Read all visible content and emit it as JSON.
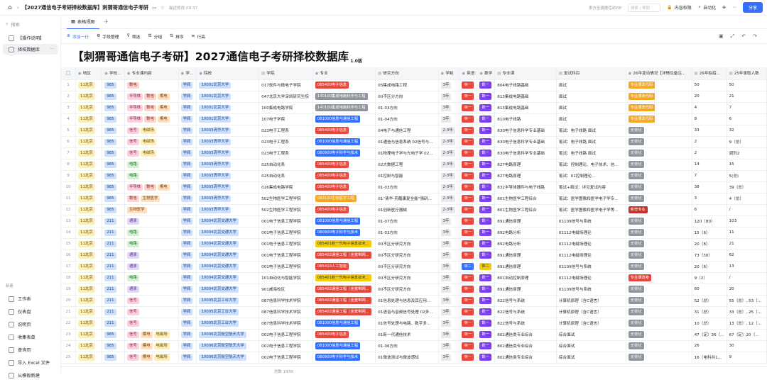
{
  "topbar": {
    "title": "【2027通信电子考研择校数据库】刺猬哥通信电子考研",
    "saved": "最近修改 00:37",
    "vip": "来方至演播活动VIP",
    "vip_box": "搜索 / 帮助",
    "btn_permission": "内容权限",
    "btn_automation": "自动化",
    "share": "分享"
  },
  "sidebar": {
    "search": "搜索",
    "items": [
      "【操作说明】",
      "择校数据库"
    ],
    "section": "新建",
    "new_items": [
      "工作表",
      "仪表盘",
      "说明页",
      "收集表单",
      "查询页",
      "导入 Excel 文件",
      "从模板新建"
    ]
  },
  "view": {
    "tab": "表格视图",
    "plus": "+"
  },
  "toolbar": {
    "add": "添加一行",
    "fields": "字段管理",
    "filter": "筛选",
    "group": "分组",
    "sort": "排序",
    "height": "行高"
  },
  "banner": {
    "title": "【刺猬哥通信电子考研】2027通信电子考研择校数据库",
    "sub": "1.0版"
  },
  "headers": [
    "",
    "地区",
    "学校...",
    "专业课内容",
    "学...",
    "院校",
    "学院",
    "专业",
    "研究方向",
    "学制",
    "英语",
    "数学",
    "专业课",
    "复试科目",
    "26年变动情况【详情见备注...",
    "26年拟招...",
    "25年录取人数"
  ],
  "header_icons": [
    "",
    "◉",
    "◉",
    "◉",
    "◉",
    "◉",
    "▤",
    "◉",
    "▤",
    "◉",
    "◉",
    "◉",
    "▤",
    "▤",
    "◉",
    "▤",
    "▤"
  ],
  "rows": [
    {
      "n": "1",
      "area": "11北京",
      "lvl": "985",
      "subj": [
        [
          "数电",
          "t-red"
        ]
      ],
      "type": "学硕",
      "school": "10001北京大学",
      "college": "017软件与微电子学院",
      "major": [
        "085400电子信息",
        "b-red"
      ],
      "dir": "05集成电路工程",
      "len": "3年",
      "en": [
        "英一",
        "b-red"
      ],
      "math": [
        "数一",
        "b-purple"
      ],
      "course": "804电子线路基础",
      "retest": "面试",
      "chg": [
        "专业课改代码",
        "b-orange"
      ],
      "plan": "50",
      "adm": "50"
    },
    {
      "n": "2",
      "area": "11北京",
      "lvl": "985",
      "subj": [
        [
          "半导体",
          "t-pink"
        ],
        [
          "数电",
          "t-red"
        ],
        [
          "模电",
          "t-orange"
        ]
      ],
      "type": "学硕",
      "school": "10001北京大学",
      "college": "047北京大学深圳研究生院",
      "major": [
        "140100集成电路科学与工程",
        "b-gray"
      ],
      "dir": "00不区分方向",
      "len": "3年",
      "en": [
        "英一",
        "b-red"
      ],
      "math": [
        "数一",
        "b-purple"
      ],
      "course": "813集成电路基础",
      "retest": "面试",
      "chg": [
        "专业课改代码",
        "b-orange"
      ],
      "plan": "20",
      "adm": "21"
    },
    {
      "n": "3",
      "area": "11北京",
      "lvl": "985",
      "subj": [
        [
          "半导体",
          "t-pink"
        ],
        [
          "数电",
          "t-red"
        ],
        [
          "模电",
          "t-orange"
        ]
      ],
      "type": "学硕",
      "school": "10001北京大学",
      "college": "100集成电路学院",
      "major": [
        "140100集成电路科学与工程",
        "b-gray"
      ],
      "dir": "01-03方向",
      "len": "3年",
      "en": [
        "英一",
        "b-red"
      ],
      "math": [
        "数一",
        "b-purple"
      ],
      "course": "813集成电路基础",
      "retest": "面试",
      "chg": [
        "专业课改代码",
        "b-orange"
      ],
      "plan": "4",
      "adm": "7"
    },
    {
      "n": "4",
      "area": "11北京",
      "lvl": "985",
      "subj": [
        [
          "半导体",
          "t-pink"
        ],
        [
          "数电",
          "t-red"
        ],
        [
          "模电",
          "t-orange"
        ]
      ],
      "type": "学硕",
      "school": "10001北京大学",
      "college": "107电子学院",
      "major": [
        "081000信息与通信工程",
        "b-blue"
      ],
      "dir": "01-04方向",
      "len": "3年",
      "en": [
        "英一",
        "b-red"
      ],
      "math": [
        "数一",
        "b-purple"
      ],
      "course": "810电子线路",
      "retest": "面试",
      "chg": [
        "专业课改代码",
        "b-orange"
      ],
      "plan": "8",
      "adm": "6"
    },
    {
      "n": "5",
      "area": "11北京",
      "lvl": "985",
      "subj": [
        [
          "信号",
          "t-pink"
        ],
        [
          "电磁场",
          "t-yellow"
        ]
      ],
      "type": "学硕",
      "school": "10003清华大学",
      "college": "023电子工程系",
      "major": [
        "085400电子信息",
        "b-red"
      ],
      "dir": "04电子与通信工程",
      "len": "2-3年",
      "en": [
        "英一",
        "b-red"
      ],
      "math": [
        "数一",
        "b-purple"
      ],
      "course": "830电子信息科学专业基础",
      "retest": "笔试：电子线路 面试",
      "chg": [
        "无变化",
        "b-gray"
      ],
      "plan": "33",
      "adm": "32"
    },
    {
      "n": "6",
      "area": "11北京",
      "lvl": "985",
      "subj": [
        [
          "信号",
          "t-pink"
        ],
        [
          "电磁场",
          "t-yellow"
        ]
      ],
      "type": "学硕",
      "school": "10003清华大学",
      "college": "023电子工程系",
      "major": [
        "081000信息与通信工程",
        "b-blue"
      ],
      "dir": "01通信与信息系统 02信号与...",
      "len": "2-3年",
      "en": [
        "英一",
        "b-red"
      ],
      "math": [
        "数一",
        "b-purple"
      ],
      "course": "830电子信息科学专业基础",
      "retest": "笔试：电子线路 面试",
      "chg": [
        "无变化",
        "b-gray"
      ],
      "plan": "2",
      "adm": "9（总）"
    },
    {
      "n": "7",
      "area": "11北京",
      "lvl": "985",
      "subj": [
        [
          "信号",
          "t-pink"
        ],
        [
          "电磁场",
          "t-yellow"
        ]
      ],
      "type": "学硕",
      "school": "10003清华大学",
      "college": "023电子工程系",
      "major": [
        "080900电子科学与技术",
        "b-blue"
      ],
      "dir": "01物理电子学与光电子学 02...",
      "len": "2-3年",
      "en": [
        "英一",
        "b-red"
      ],
      "math": [
        "数一",
        "b-purple"
      ],
      "course": "830电子信息科学专业基础",
      "retest": "笔试：电子线路 面试",
      "chg": [
        "无变化",
        "b-gray"
      ],
      "plan": "2",
      "adm": "调剂2"
    },
    {
      "n": "8",
      "area": "11北京",
      "lvl": "985",
      "subj": [
        [
          "电路",
          "t-green"
        ]
      ],
      "type": "学硕",
      "school": "10003清华大学",
      "college": "025自动化系",
      "major": [
        "085400电子信息",
        "b-red"
      ],
      "dir": "02大数据工程",
      "len": "2-3年",
      "en": [
        "英一",
        "b-red"
      ],
      "math": [
        "数一",
        "b-purple"
      ],
      "course": "827电路原理",
      "retest": "笔试：控制理论、电子技术、信...",
      "chg": [
        "无变化",
        "b-gray"
      ],
      "plan": "14",
      "adm": "15"
    },
    {
      "n": "9",
      "area": "11北京",
      "lvl": "985",
      "subj": [
        [
          "电路",
          "t-green"
        ]
      ],
      "type": "学硕",
      "school": "10003清华大学",
      "college": "025自动化系",
      "major": [
        "085400电子信息",
        "b-red"
      ],
      "dir": "01控制与智能",
      "len": "2-3年",
      "en": [
        "英一",
        "b-red"
      ],
      "math": [
        "数一",
        "b-purple"
      ],
      "course": "827电路原理",
      "retest": "笔试：01控制理论...",
      "chg": [
        "无变化",
        "b-gray"
      ],
      "plan": "7",
      "adm": "5(总)"
    },
    {
      "n": "10",
      "area": "11北京",
      "lvl": "985",
      "subj": [
        [
          "半导体",
          "t-pink"
        ],
        [
          "数电",
          "t-red"
        ],
        [
          "模电",
          "t-orange"
        ]
      ],
      "type": "学硕",
      "school": "10003清华大学",
      "college": "026集成电路学院",
      "major": [
        "085400电子信息",
        "b-red"
      ],
      "dir": "01-03方向",
      "len": "2-3年",
      "en": [
        "英一",
        "b-red"
      ],
      "math": [
        "数一",
        "b-purple"
      ],
      "course": "832半导体器件与电子线路",
      "retest": "笔试+面试：详见复试内容",
      "chg": [
        "无变化",
        "b-gray"
      ],
      "plan": "38",
      "adm": "39（总）"
    },
    {
      "n": "11",
      "area": "11北京",
      "lvl": "985",
      "subj": [
        [
          "数电",
          "t-red"
        ],
        [
          "生物医学",
          "t-orange"
        ]
      ],
      "type": "学硕",
      "school": "10003清华大学",
      "college": "502生物医学工程学院",
      "major": [
        "083100生物医学工程",
        "b-orange"
      ],
      "dir": "01\"清华-药膳康复全能\"强研...",
      "len": "2-3年",
      "en": [
        "英一",
        "b-red"
      ],
      "math": [
        "数一",
        "b-purple"
      ],
      "course": "801生物医学工程综合",
      "retest": "笔试：医学图像和医学电子学专...",
      "chg": [
        "无变化",
        "b-gray"
      ],
      "plan": "3",
      "adm": "4（总）"
    },
    {
      "n": "12",
      "area": "11北京",
      "lvl": "985",
      "subj": [
        [
          "生物医学",
          "t-orange"
        ]
      ],
      "type": "学硕",
      "school": "10003清华大学",
      "college": "502生物医学工程学院",
      "major": [
        "085400电子信息",
        "b-red"
      ],
      "dir": "01创新医疗器械",
      "len": "2-3年",
      "en": [
        "英一",
        "b-red"
      ],
      "math": [
        "数一",
        "b-purple"
      ],
      "course": "801生物医学工程综合",
      "retest": "笔试：医学图像和医学电子学等...",
      "chg": [
        "新增专业",
        "b-maroon"
      ],
      "plan": "6",
      "adm": "/"
    },
    {
      "n": "13",
      "area": "11北京",
      "lvl": "211",
      "subj": [
        [
          "通原",
          "t-purple"
        ]
      ],
      "type": "学硕",
      "school": "10004北京交通大学",
      "college": "001电子信息工程学院",
      "major": [
        "081000信息与通信工程",
        "b-blue"
      ],
      "dir": "01-07方向",
      "len": "3年",
      "en": [
        "英一",
        "b-red"
      ],
      "math": [
        "数一",
        "b-purple"
      ],
      "course": "891通信原理",
      "retest": "01109信号与系统",
      "chg": [
        "无变化",
        "b-gray"
      ],
      "plan": "120（80）",
      "adm": "103"
    },
    {
      "n": "14",
      "area": "11北京",
      "lvl": "211",
      "subj": [
        [
          "电路",
          "t-green"
        ]
      ],
      "type": "学硕",
      "school": "10004北京交通大学",
      "college": "001电子信息工程学院",
      "major": [
        "080900电子科学与技术",
        "b-blue"
      ],
      "dir": "01-03方向",
      "len": "3年",
      "en": [
        "英一",
        "b-red"
      ],
      "math": [
        "数一",
        "b-purple"
      ],
      "course": "892电路分析",
      "retest": "01112电磁场理论",
      "chg": [
        "无变化",
        "b-gray"
      ],
      "plan": "15（8）",
      "adm": "11"
    },
    {
      "n": "15",
      "area": "11北京",
      "lvl": "211",
      "subj": [
        [
          "电路",
          "t-green"
        ]
      ],
      "type": "学硕",
      "school": "10004北京交通大学",
      "college": "001电子信息工程学院",
      "major": [
        "085401新一代电子信息技术...",
        "b-yellow"
      ],
      "dir": "00不区分研究方向",
      "len": "3年",
      "en": [
        "英一",
        "b-red"
      ],
      "math": [
        "数一",
        "b-purple"
      ],
      "course": "892电路分析",
      "retest": "01112电磁场理论",
      "chg": [
        "无变化",
        "b-gray"
      ],
      "plan": "20（8）",
      "adm": "21"
    },
    {
      "n": "16",
      "area": "11北京",
      "lvl": "211",
      "subj": [
        [
          "通原",
          "t-purple"
        ]
      ],
      "type": "学硕",
      "school": "10004北京交通大学",
      "college": "001电子信息工程学院",
      "major": [
        "085402通信工程（含宽带网...",
        "b-red"
      ],
      "dir": "00不区分研究方向",
      "len": "3年",
      "en": [
        "英一",
        "b-red"
      ],
      "math": [
        "数一",
        "b-purple"
      ],
      "course": "891通信原理",
      "retest": "01112电磁场理论",
      "chg": [
        "无变化",
        "b-gray"
      ],
      "plan": "73（30）",
      "adm": "62"
    },
    {
      "n": "17",
      "area": "11北京",
      "lvl": "211",
      "subj": [
        [
          "通原",
          "t-purple"
        ]
      ],
      "type": "学硕",
      "school": "10004北京交通大学",
      "college": "001电子信息工程学院",
      "major": [
        "085410人工智能",
        "b-red"
      ],
      "dir": "00不区分研究方向",
      "len": "3年",
      "en": [
        "英二",
        "b-blue"
      ],
      "math": [
        "数二",
        "b-yellow"
      ],
      "course": "891通信原理",
      "retest": "01109信号与系统",
      "chg": [
        "无变化",
        "b-gray"
      ],
      "plan": "20（8）",
      "adm": "13"
    },
    {
      "n": "18",
      "area": "11北京",
      "lvl": "211",
      "subj": [
        [
          "电路",
          "t-green"
        ]
      ],
      "type": "学硕",
      "school": "10004北京交通大学",
      "college": "101自动化与智能学院",
      "major": [
        "085401新一代电子信息技术...",
        "b-yellow"
      ],
      "dir": "00不区分研究方向",
      "len": "3年",
      "en": [
        "英一",
        "b-red"
      ],
      "math": [
        "数一",
        "b-purple"
      ],
      "course": "801自动控制原理",
      "retest": "01112电磁场理论",
      "chg": [
        "专业课改考",
        "b-red"
      ],
      "plan": "9（2）",
      "adm": "/"
    },
    {
      "n": "19",
      "area": "11北京",
      "lvl": "211",
      "subj": [
        [
          "通原",
          "t-purple"
        ]
      ],
      "type": "学硕",
      "school": "10004北京交通大学",
      "college": "901威海校区",
      "major": [
        "085402通信工程（含宽带网...",
        "b-red"
      ],
      "dir": "00不区分研究方向",
      "len": "3年",
      "en": [
        "英一",
        "b-red"
      ],
      "math": [
        "数一",
        "b-purple"
      ],
      "course": "891通信原理",
      "retest": "01109信号与系统",
      "chg": [
        "无变化",
        "b-gray"
      ],
      "plan": "60",
      "adm": "20"
    },
    {
      "n": "20",
      "area": "11北京",
      "lvl": "211",
      "subj": [
        [
          "信号",
          "t-pink"
        ]
      ],
      "type": "学硕",
      "school": "10005北京工业大学",
      "college": "087信息科学技术学院",
      "major": [
        "085402通信工程（含宽带网...",
        "b-red"
      ],
      "dir": "01信息处理与信息及其应用...",
      "len": "3年",
      "en": [
        "英一",
        "b-red"
      ],
      "math": [
        "数一",
        "b-purple"
      ],
      "course": "822信号与系统",
      "retest": "计算机原理（含C语言）",
      "chg": [
        "无变化",
        "b-gray"
      ],
      "plan": "52（总）",
      "adm": "55（总）, 53（..."
    },
    {
      "n": "21",
      "area": "11北京",
      "lvl": "211",
      "subj": [
        [
          "信号",
          "t-pink"
        ]
      ],
      "type": "学硕",
      "school": "10005北京工业大学",
      "college": "087信息科学技术学院",
      "major": [
        "085402通信工程（含宽带网...",
        "b-red"
      ],
      "dir": "01语音与音频信号处理 02多...",
      "len": "3年",
      "en": [
        "英一",
        "b-red"
      ],
      "math": [
        "数一",
        "b-purple"
      ],
      "course": "822信号与系统",
      "retest": "计算机原理（含C语言）",
      "chg": [
        "无变化",
        "b-gray"
      ],
      "plan": "31（总）",
      "adm": "33（总）, 25（..."
    },
    {
      "n": "22",
      "area": "11北京",
      "lvl": "211",
      "subj": [
        [
          "信号",
          "t-pink"
        ]
      ],
      "type": "学硕",
      "school": "10005北京工业大学",
      "college": "087信息科学技术学院",
      "major": [
        "081000信息与通信工程",
        "b-blue"
      ],
      "dir": "01信号处理与电路、数字多...",
      "len": "3年",
      "en": [
        "英一",
        "b-red"
      ],
      "math": [
        "数一",
        "b-purple"
      ],
      "course": "822信号与系统",
      "retest": "计算机原理（含C语言）",
      "chg": [
        "无变化",
        "b-gray"
      ],
      "plan": "10（总）",
      "adm": "13（总）, 12（..."
    },
    {
      "n": "23",
      "area": "11北京",
      "lvl": "985",
      "subj": [
        [
          "信号",
          "t-pink"
        ],
        [
          "模电",
          "t-orange"
        ],
        [
          "电磁场",
          "t-yellow"
        ]
      ],
      "type": "学硕",
      "school": "10006北京航空航天大学",
      "college": "002电子信息工程学院",
      "major": [
        "085400电子信息",
        "b-red"
      ],
      "dir": "01新一代通信技术",
      "len": "3年",
      "en": [
        "英一",
        "b-red"
      ],
      "math": [
        "数一",
        "b-purple"
      ],
      "course": "802通信类专业综合",
      "retest": "综合面试",
      "chg": [
        "无变化",
        "b-gray"
      ],
      "plan": "47（定）36（...",
      "adm": "67（定）20（..."
    },
    {
      "n": "24",
      "area": "11北京",
      "lvl": "985",
      "subj": [
        [
          "信号",
          "t-pink"
        ],
        [
          "模电",
          "t-orange"
        ],
        [
          "电磁场",
          "t-yellow"
        ]
      ],
      "type": "学硕",
      "school": "10006北京航空航天大学",
      "college": "002电子信息工程学院",
      "major": [
        "081000信息与通信工程",
        "b-blue"
      ],
      "dir": "01-06方向",
      "len": "3年",
      "en": [
        "英一",
        "b-red"
      ],
      "math": [
        "数一",
        "b-purple"
      ],
      "course": "802通信类专业综合",
      "retest": "综合面试",
      "chg": [
        "无变化",
        "b-gray"
      ],
      "plan": "26",
      "adm": "30"
    },
    {
      "n": "25",
      "area": "11北京",
      "lvl": "985",
      "subj": [
        [
          "信号",
          "t-pink"
        ],
        [
          "模电",
          "t-orange"
        ],
        [
          "电磁场",
          "t-yellow"
        ]
      ],
      "type": "学硕",
      "school": "10006北京航空航天大学",
      "college": "002电子信息工程学院",
      "major": [
        "080900电子科学与技术",
        "b-blue"
      ],
      "dir": "01微波测试与微波感知",
      "len": "3年",
      "en": [
        "英一",
        "b-red"
      ],
      "math": [
        "数一",
        "b-purple"
      ],
      "course": "802通信类专业综合",
      "retest": "综合面试",
      "chg": [
        "无变化",
        "b-gray"
      ],
      "plan": "16（电科共1...",
      "adm": "9"
    }
  ],
  "footer": {
    "count": "总数 1978"
  }
}
